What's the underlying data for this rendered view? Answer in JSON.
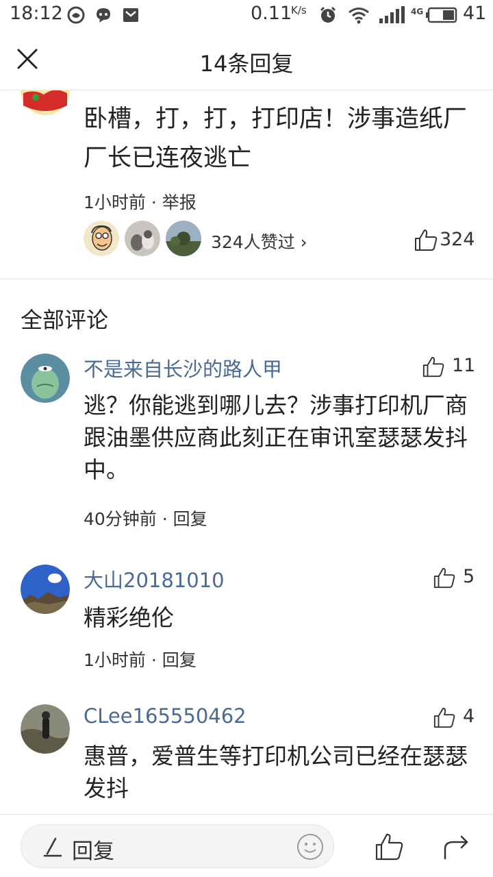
{
  "status_bar": {
    "time": "18:12",
    "net_speed": "0.11",
    "net_unit": "K/s",
    "network_type": "4G",
    "battery": "41"
  },
  "header": {
    "title": "14条回复"
  },
  "top_reply": {
    "text": "卧槽，打，打，打印店！涉事造纸厂厂长已连夜逃亡",
    "time": "1小时前",
    "action": "举报",
    "likes_text": "324人赞过",
    "like_count": "324"
  },
  "section_title": "全部评论",
  "comments": [
    {
      "user": "不是来自长沙的路人甲",
      "likes": "11",
      "text": "逃？你能逃到哪儿去？涉事打印机厂商跟油墨供应商此刻正在审讯室瑟瑟发抖中。",
      "time": "40分钟前",
      "action": "回复"
    },
    {
      "user": "大山20181010",
      "likes": "5",
      "text": "精彩绝伦",
      "time": "1小时前",
      "action": "回复"
    },
    {
      "user": "CLee165550462",
      "likes": "4",
      "text": "惠普，爱普生等打印机公司已经在瑟瑟发抖",
      "time": "",
      "action": ""
    }
  ],
  "bottom_bar": {
    "reply_label": "回复"
  },
  "colors": {
    "username": "#4a6a96",
    "text": "#222222",
    "divider": "#ececec"
  }
}
